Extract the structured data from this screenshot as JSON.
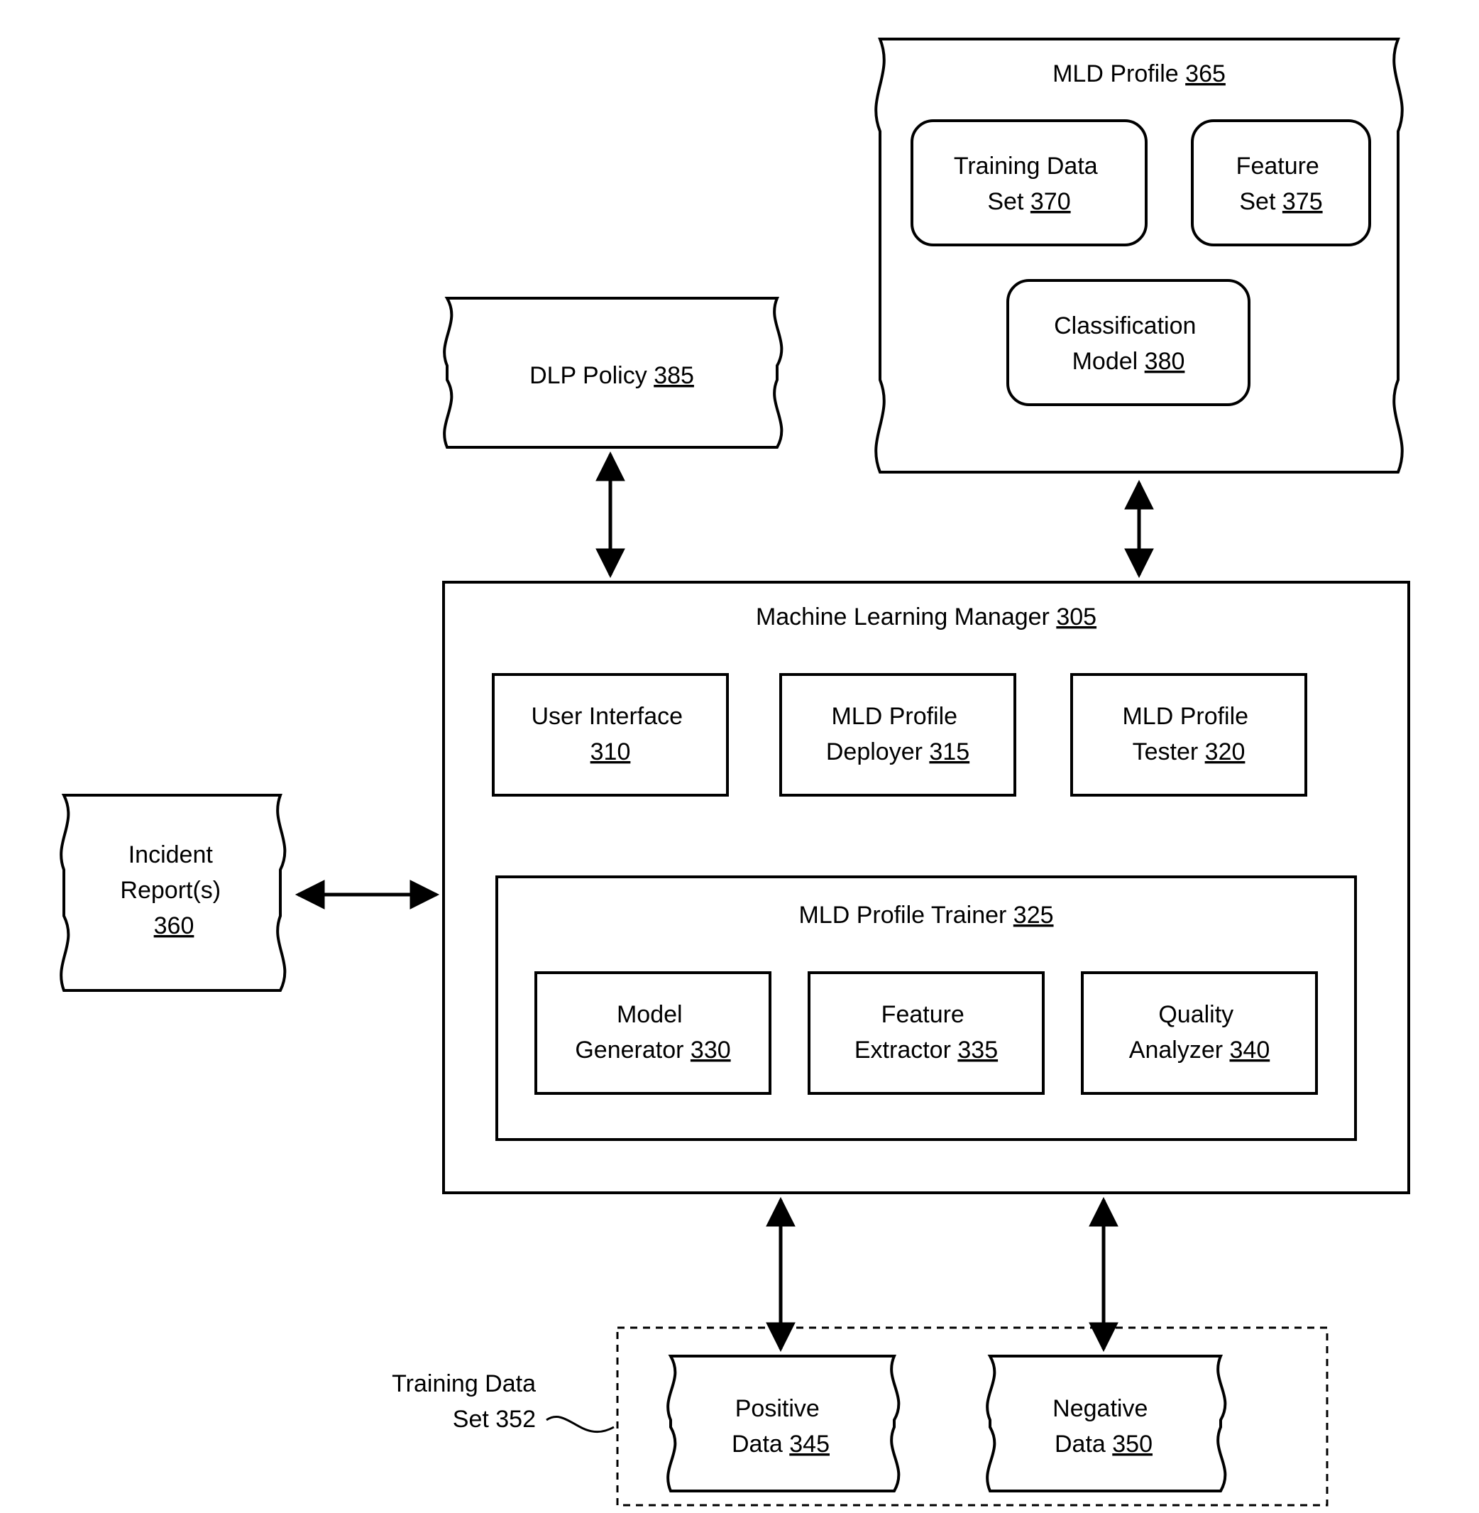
{
  "dlp_policy": {
    "label": "DLP Policy",
    "ref": "385"
  },
  "mld_profile": {
    "label": "MLD Profile",
    "ref": "365"
  },
  "training_data_set": {
    "label": "Training Data",
    "label2": "Set",
    "ref": "370"
  },
  "feature_set": {
    "label": "Feature",
    "label2": "Set",
    "ref": "375"
  },
  "classification": {
    "label": "Classification",
    "label2": "Model",
    "ref": "380"
  },
  "mlm": {
    "label": "Machine Learning Manager",
    "ref": "305"
  },
  "ui": {
    "label": "User Interface",
    "ref": "310"
  },
  "deployer": {
    "label": "MLD Profile",
    "label2": "Deployer",
    "ref": "315"
  },
  "tester": {
    "label": "MLD Profile",
    "label2": "Tester",
    "ref": "320"
  },
  "trainer": {
    "label": "MLD Profile Trainer",
    "ref": "325"
  },
  "model_gen": {
    "label": "Model",
    "label2": "Generator",
    "ref": "330"
  },
  "feat_ext": {
    "label": "Feature",
    "label2": "Extractor",
    "ref": "335"
  },
  "qual": {
    "label": "Quality",
    "label2": "Analyzer",
    "ref": "340"
  },
  "incident": {
    "label": "Incident",
    "label2": "Report(s)",
    "ref": "360"
  },
  "tds_group": {
    "label": "Training Data",
    "label2": "Set 352"
  },
  "positive": {
    "label": "Positive",
    "label2": "Data",
    "ref": "345"
  },
  "negative": {
    "label": "Negative",
    "label2": "Data",
    "ref": "350"
  }
}
